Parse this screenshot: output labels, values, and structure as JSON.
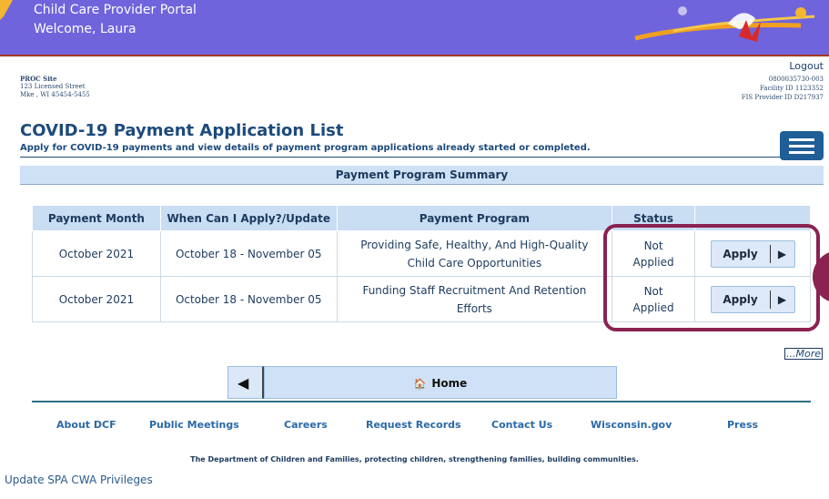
{
  "header": {
    "title": "Child Care Provider Portal",
    "welcome": "Welcome, Laura"
  },
  "provider": {
    "name": "PROC Site",
    "address1": "123 Licensed Street",
    "address2": "Mke , WI 45454-5455",
    "logout_label": "Logout",
    "provider_number": "0800035730-003",
    "facility_id": "Facility ID 1123352",
    "fis_provider_id": "FIS Provider ID D217937"
  },
  "page": {
    "title": "COVID-19 Payment Application List",
    "subtitle": "Apply for COVID-19 payments and view details of payment program applications already started or completed.",
    "section_title": "Payment Program Summary",
    "menu_icon": "hamburger-menu-icon"
  },
  "table": {
    "columns": [
      "Payment Month",
      "When Can I Apply?/Update",
      "Payment Program",
      "Status",
      ""
    ],
    "rows": [
      {
        "month": "October 2021",
        "window": "October 18 - November 05",
        "program_line1": "Providing Safe, Healthy, And High-Quality",
        "program_line2": "Child Care Opportunities",
        "status_line1": "Not",
        "status_line2": "Applied",
        "action_label": "Apply"
      },
      {
        "month": "October 2021",
        "window": "October 18 - November 05",
        "program_line1": "Funding Staff Recruitment And Retention",
        "program_line2": "Efforts",
        "status_line1": "Not",
        "status_line2": "Applied",
        "action_label": "Apply"
      }
    ]
  },
  "more_label": "...More",
  "home_label": "Home",
  "footer": {
    "links": [
      "About DCF",
      "Public Meetings",
      "Careers",
      "Request Records",
      "Contact Us",
      "Wisconsin.gov",
      "Press"
    ],
    "tagline": "The Department of Children and Families, protecting children, strengthening families, building communities.",
    "update_link": "Update SPA CWA Privileges"
  },
  "colors": {
    "banner": "#6f64dc",
    "highlight": "#8b2252",
    "table_header": "#c9ddf3",
    "link": "#2a69a8"
  }
}
